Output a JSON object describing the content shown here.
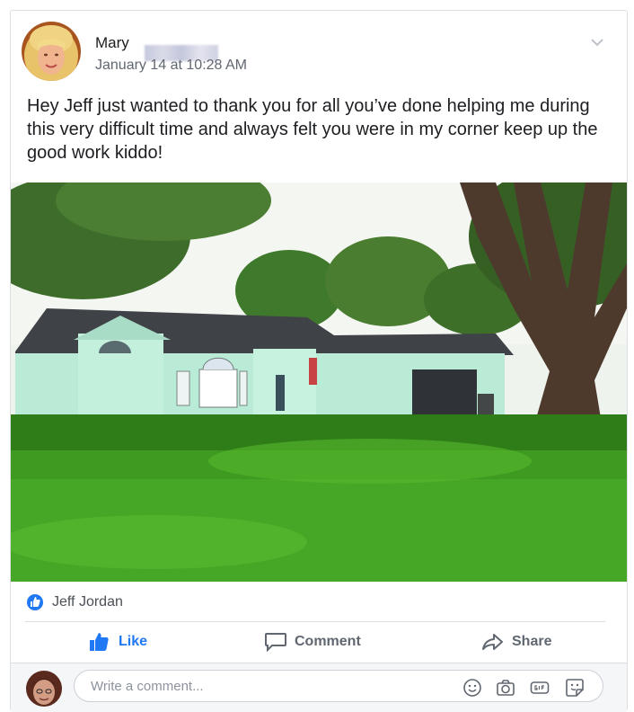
{
  "post": {
    "author": "Mary",
    "timestamp": "January 14 at 10:28 AM",
    "text": "Hey Jeff just wanted to thank you for all you’ve done helping me during this very difficult time and always felt you were in my corner keep up the good work kiddo!"
  },
  "reactions": {
    "names": "Jeff Jordan"
  },
  "actions": {
    "like": "Like",
    "comment": "Comment",
    "share": "Share"
  },
  "comment_input": {
    "placeholder": "Write a comment..."
  },
  "icons": {
    "options": "chevron-down-icon",
    "like_badge": "thumbs-up-icon",
    "like": "thumbs-up-icon",
    "comment": "speech-bubble-icon",
    "share": "share-arrow-icon",
    "emoji": "emoji-icon",
    "camera": "camera-icon",
    "gif": "gif-icon",
    "sticker": "sticker-icon"
  },
  "colors": {
    "accent": "#2078f4",
    "text": "#1c1e21",
    "muted": "#616770"
  }
}
